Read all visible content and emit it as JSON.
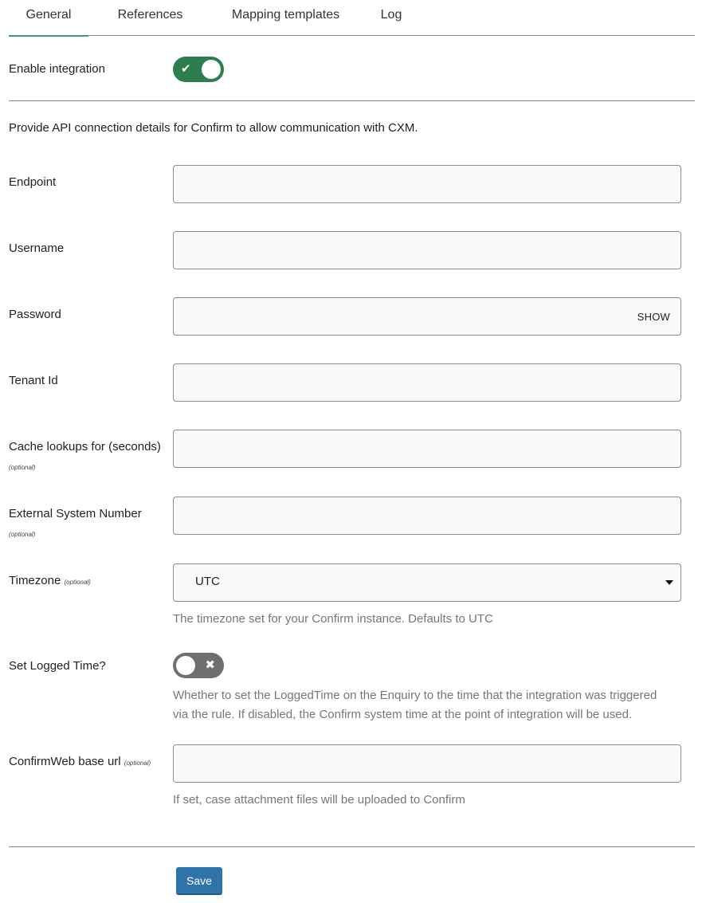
{
  "tabs": [
    {
      "label": "General",
      "active": true
    },
    {
      "label": "References",
      "active": false
    },
    {
      "label": "Mapping templates",
      "active": false
    },
    {
      "label": "Log",
      "active": false
    }
  ],
  "enable_integration": {
    "label": "Enable integration",
    "enabled": true,
    "on_icon": "check-icon",
    "on_glyph": "✔"
  },
  "intro_text": "Provide API connection details for Confirm to allow communication with CXM.",
  "optional_label": "(optional)",
  "fields": {
    "endpoint": {
      "label": "Endpoint",
      "value": ""
    },
    "username": {
      "label": "Username",
      "value": ""
    },
    "password": {
      "label": "Password",
      "value": "",
      "show_label": "SHOW"
    },
    "tenant_id": {
      "label": "Tenant Id",
      "value": ""
    },
    "cache_lookups": {
      "label": "Cache lookups for (seconds)",
      "value": ""
    },
    "external_system_number": {
      "label": "External System Number",
      "value": ""
    },
    "timezone": {
      "label": "Timezone",
      "selected": "UTC",
      "help": "The timezone set for your Confirm instance. Defaults to UTC"
    },
    "set_logged_time": {
      "label": "Set Logged Time?",
      "enabled": false,
      "off_icon": "x-icon",
      "off_glyph": "✖",
      "help_line1": "Whether to set the LoggedTime on the Enquiry to the time that the integration was triggered",
      "help_line2": "via the rule. If disabled, the Confirm system time at the point of integration will be used."
    },
    "confirmweb_base_url": {
      "label": "ConfirmWeb base url",
      "value": "",
      "help": "If set, case attachment files will be uploaded to Confirm"
    }
  },
  "colors": {
    "tab_active_underline": "#4a9089",
    "toggle_on": "#2e7d4f",
    "toggle_off": "#6f6f6f",
    "primary_button": "#2f73ab"
  },
  "save_button": {
    "label": "Save"
  }
}
